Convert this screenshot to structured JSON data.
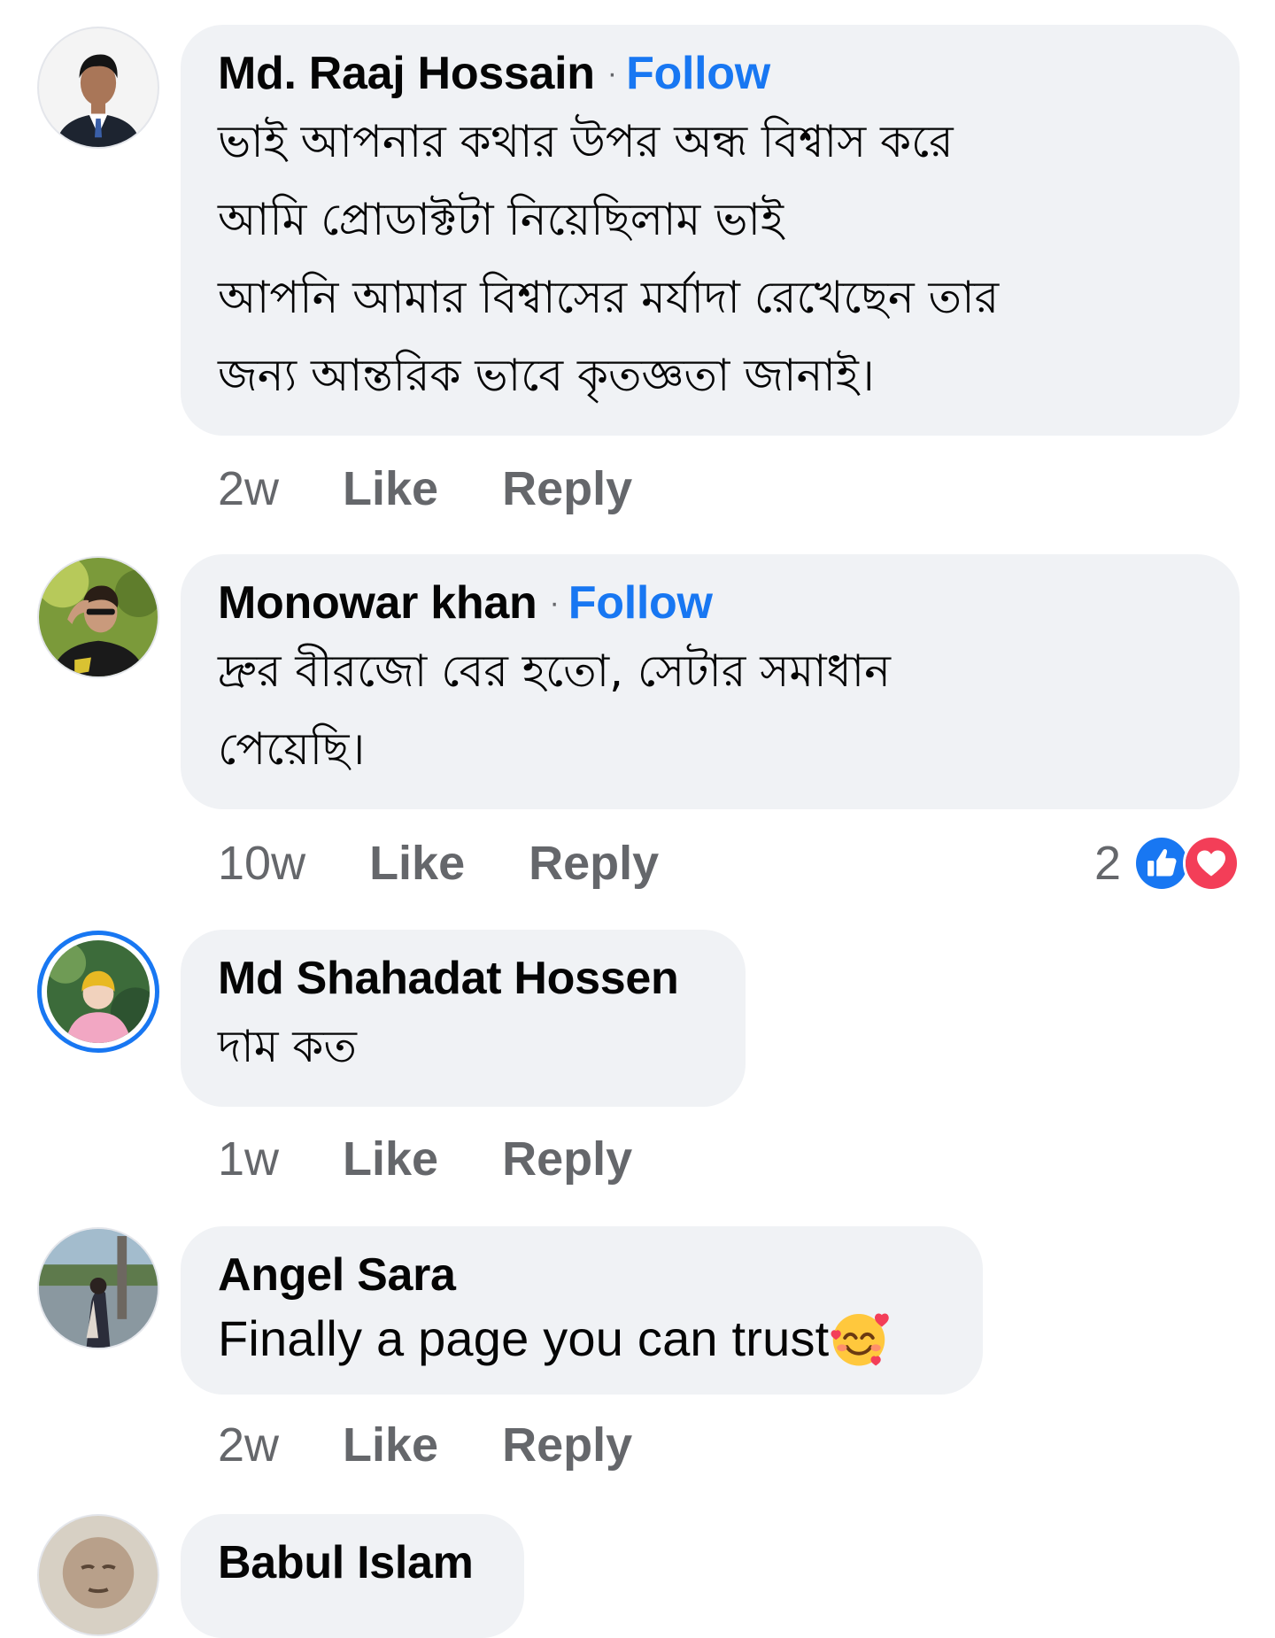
{
  "comments": [
    {
      "author": "Md. Raaj Hossain",
      "separator": "·",
      "follow_label": "Follow",
      "text_lines": [
        "ভাই আপনার কথার উপর অন্ধ বিশ্বাস করে",
        "আমি প্রোডাক্টটা নিয়েছিলাম ভাই",
        "আপনি আমার বিশ্বাসের মর্যাদা রেখেছেন তার",
        "জন্য আন্তরিক ভাবে কৃতজ্ঞতা জানাই।"
      ],
      "time": "2w",
      "like_label": "Like",
      "reply_label": "Reply"
    },
    {
      "author": "Monowar khan",
      "separator": "·",
      "follow_label": "Follow",
      "text_lines": [
        "দ্রুর বীরজো বের হতো, সেটার সমাধান",
        "পেয়েছি।"
      ],
      "time": "10w",
      "like_label": "Like",
      "reply_label": "Reply",
      "reaction_count": "2",
      "reaction_icons": [
        "like-icon",
        "love-icon"
      ]
    },
    {
      "author": "Md Shahadat Hossen",
      "text_lines": [
        "দাম কত"
      ],
      "time": "1w",
      "like_label": "Like",
      "reply_label": "Reply",
      "has_story_ring": true
    },
    {
      "author": "Angel Sara",
      "text_lines": [
        "Finally a page you can trust"
      ],
      "emoji": "smiling-face-with-hearts-emoji",
      "time": "2w",
      "like_label": "Like",
      "reply_label": "Reply"
    },
    {
      "author": "Babul Islam"
    }
  ],
  "colors": {
    "bubble": "#f0f2f5",
    "follow": "#1877f2",
    "meta": "#65676b",
    "text": "#050505",
    "like_reaction": "#1877f2",
    "love_reaction": "#f33e58"
  }
}
